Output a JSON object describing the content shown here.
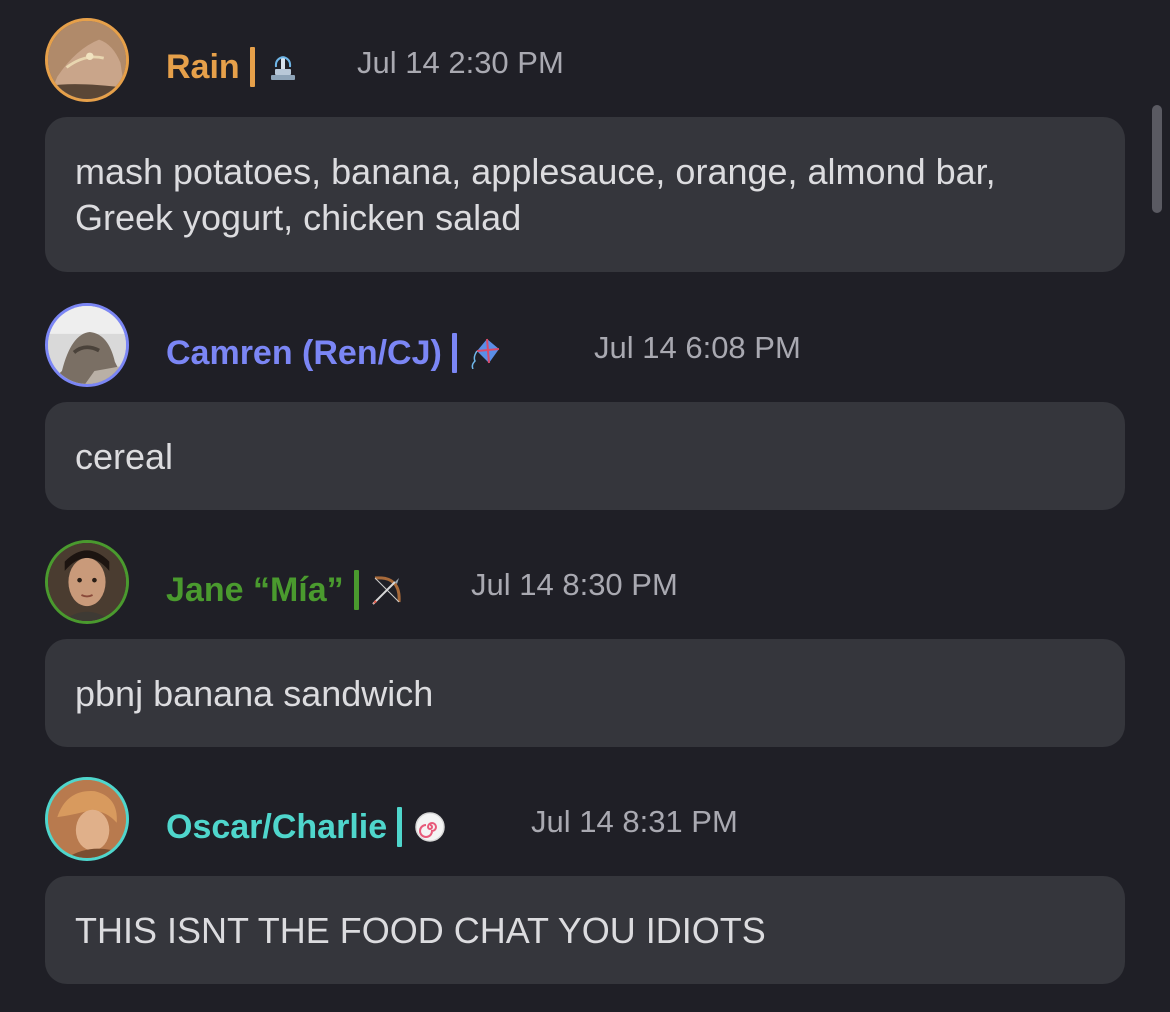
{
  "messages": [
    {
      "username": "Rain",
      "name_color": "#e6a04a",
      "emoji": "fountain-icon",
      "timestamp": "Jul 14 2:30 PM",
      "text": "mash potatoes, banana, applesauce, orange, almond bar, Greek yogurt, chicken salad"
    },
    {
      "username": "Camren (Ren/CJ)",
      "name_color": "#7b86f5",
      "emoji": "kite-icon",
      "timestamp": "Jul 14 6:08 PM",
      "text": "cereal"
    },
    {
      "username": "Jane “Mía”",
      "name_color": "#4a9a2e",
      "emoji": "bow-and-arrow-icon",
      "timestamp": "Jul 14 8:30 PM",
      "text": "pbnj banana sandwich"
    },
    {
      "username": "Oscar/Charlie",
      "name_color": "#4fd6cc",
      "emoji": "fish-cake-icon",
      "timestamp": "Jul 14 8:31 PM",
      "text": "THIS ISNT THE FOOD CHAT YOU IDIOTS"
    }
  ]
}
